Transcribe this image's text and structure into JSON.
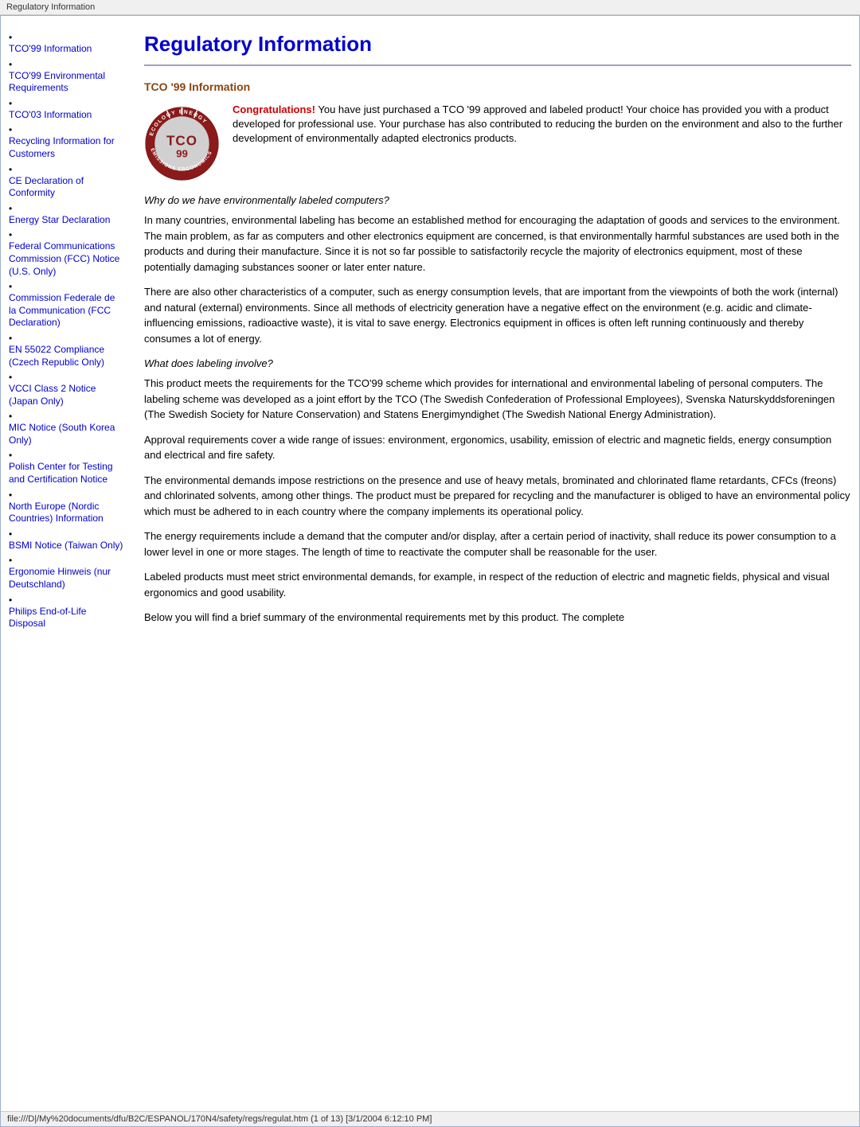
{
  "browser": {
    "title": "Regulatory Information"
  },
  "sidebar": {
    "items": [
      {
        "id": "tco99-info",
        "label": "TCO'99 Information",
        "dot": true
      },
      {
        "id": "tco99-env",
        "label": "TCO'99 Environmental Requirements",
        "dot": true
      },
      {
        "id": "tco03-info",
        "label": "TCO'03 Information",
        "dot": true
      },
      {
        "id": "recycling-info",
        "label": "Recycling Information for Customers",
        "dot": true
      },
      {
        "id": "ce-declaration",
        "label": "CE Declaration of Conformity",
        "dot": true
      },
      {
        "id": "energy-star",
        "label": "Energy Star Declaration",
        "dot": true
      },
      {
        "id": "fcc-notice",
        "label": "Federal Communications Commission (FCC) Notice (U.S. Only)",
        "dot": true
      },
      {
        "id": "commission-fed",
        "label": "Commission Federale de la Communication (FCC Declaration)",
        "dot": true
      },
      {
        "id": "en55022",
        "label": "EN 55022 Compliance (Czech Republic Only)",
        "dot": true
      },
      {
        "id": "vcci",
        "label": "VCCI Class 2 Notice (Japan Only)",
        "dot": true
      },
      {
        "id": "mic-notice",
        "label": "MIC Notice (South Korea Only)",
        "dot": true
      },
      {
        "id": "polish-center",
        "label": "Polish Center for Testing and Certification Notice",
        "dot": true
      },
      {
        "id": "north-europe",
        "label": "North Europe (Nordic Countries) Information",
        "dot": true
      },
      {
        "id": "bsmi",
        "label": "BSMI Notice (Taiwan Only)",
        "dot": true
      },
      {
        "id": "ergonomie",
        "label": "Ergonomie Hinweis (nur Deutschland)",
        "dot": true
      },
      {
        "id": "philips-disposal",
        "label": "Philips End-of-Life Disposal",
        "dot": true
      }
    ]
  },
  "page": {
    "title": "Regulatory Information",
    "section1": {
      "heading": "TCO '99 Information",
      "congrats_prefix": "Congratulations!",
      "congrats_text": " You have just purchased a TCO '99 approved and labeled product! Your choice has provided you with a product developed for professional use. Your purchase has also contributed to reducing the burden on the environment and also to the further development of environmentally adapted electronics products.",
      "italic1": "Why do we have environmentally labeled computers?",
      "para1": "In many countries, environmental labeling has become an established method for encouraging the adaptation of goods and services to the environment. The main problem, as far as computers and other electronics equipment are concerned, is that environmentally harmful substances are used both in the products and during their manufacture. Since it is not so far possible to satisfactorily recycle the majority of electronics equipment, most of these potentially damaging substances sooner or later enter nature.",
      "para2": "There are also other characteristics of a computer, such as energy consumption levels, that are important from the viewpoints of both the work (internal) and natural (external) environments. Since all methods of electricity generation have a negative effect on the environment (e.g. acidic and climate-influencing emissions, radioactive waste), it is vital to save energy. Electronics equipment in offices is often left running continuously and thereby consumes a lot of energy.",
      "italic2": "What does labeling involve?",
      "para3": "This product meets the requirements for the TCO'99 scheme which provides for international and environmental labeling of personal computers. The labeling scheme was developed as a joint effort by the TCO (The Swedish Confederation of Professional Employees), Svenska Naturskyddsforeningen (The Swedish Society for Nature Conservation) and Statens Energimyndighet (The Swedish National Energy Administration).",
      "para4": "Approval requirements cover a wide range of issues: environment, ergonomics, usability, emission of electric and magnetic fields, energy consumption and electrical and fire safety.",
      "para5": "The environmental demands impose restrictions on the presence and use of heavy metals, brominated and chlorinated flame retardants, CFCs (freons) and chlorinated solvents, among other things. The product must be prepared for recycling and the manufacturer is obliged to have an environmental policy which must be adhered to in each country where the company implements its operational policy.",
      "para6": "The energy requirements include a demand that the computer and/or display, after a certain period of inactivity, shall reduce its power consumption to a lower level in one or more stages. The length of time to reactivate the computer shall be reasonable for the user.",
      "para7": "Labeled products must meet strict environmental demands, for example, in respect of the reduction of electric and magnetic fields, physical and visual ergonomics and good usability.",
      "para8": "Below you will find a brief summary of the environmental requirements met by this product. The complete"
    }
  },
  "status_bar": {
    "text": "file:///D|/My%20documents/dfu/B2C/ESPANOL/170N4/safety/regs/regulat.htm (1 of 13) [3/1/2004 6:12:10 PM]"
  }
}
